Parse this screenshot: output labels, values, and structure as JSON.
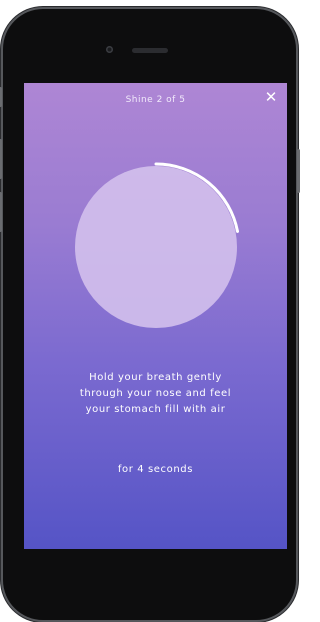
{
  "header": {
    "title": "Shine 2 of 5",
    "close_icon": "close-icon"
  },
  "breath": {
    "progress": 0.22,
    "instruction": "Hold your breath gently\nthrough your nose and feel\nyour stomach fill with air",
    "duration": "for 4 seconds"
  },
  "colors": {
    "gradient_top": "#ae86d4",
    "gradient_bottom": "#5554c6",
    "circle_fill": "#d3c0ec",
    "ring_stroke": "#ffffff"
  }
}
